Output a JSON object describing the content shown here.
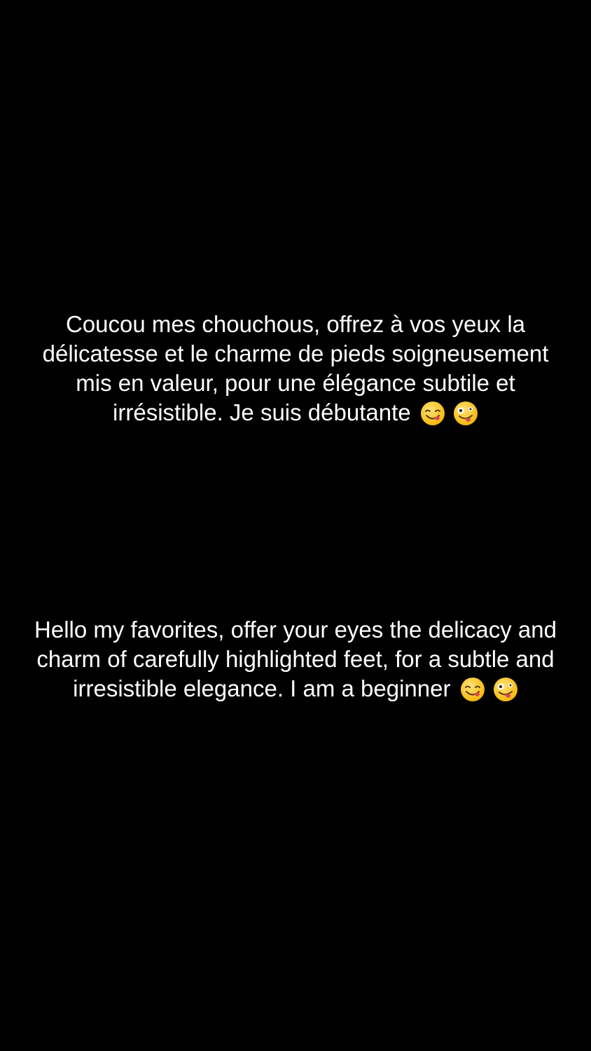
{
  "story": {
    "background_color": "#000000",
    "text_color": "#ffffff",
    "french": {
      "text": "Coucou mes chouchous, offrez à vos yeux la délicatesse et le charme de pieds soigneusement mis en valeur, pour une élégance subtile et irrésistible. Je suis débutante",
      "emojis": [
        "face-savoring-food-icon",
        "zany-face-icon"
      ]
    },
    "english": {
      "text": "Hello my favorites, offer your eyes the delicacy and charm of carefully highlighted feet, for a subtle and irresistible elegance. I am a beginner",
      "emojis": [
        "face-savoring-food-icon",
        "zany-face-icon"
      ]
    }
  }
}
